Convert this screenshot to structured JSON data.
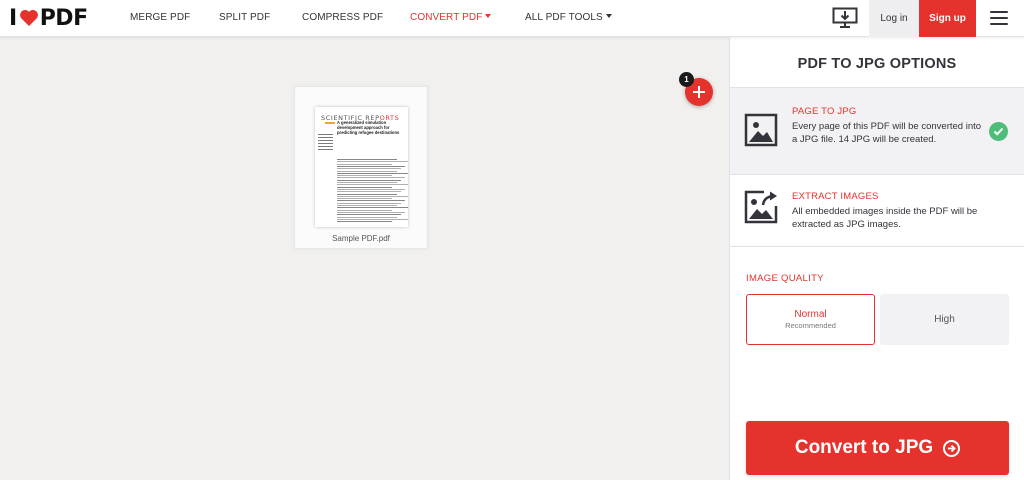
{
  "header": {
    "logo": {
      "prefix": "I",
      "suffix": "PDF"
    },
    "nav": [
      {
        "label": "MERGE PDF"
      },
      {
        "label": "SPLIT PDF"
      },
      {
        "label": "COMPRESS PDF"
      },
      {
        "label": "CONVERT PDF"
      },
      {
        "label": "ALL PDF TOOLS"
      }
    ],
    "login_label": "Log in",
    "signup_label": "Sign up"
  },
  "workspace": {
    "file": {
      "name": "Sample PDF.pdf",
      "preview_title_a": "SCIENTIFIC REP",
      "preview_title_b": "ORTS",
      "preview_heading": "A generalized simulation development approach for predicting refugee destinations"
    },
    "file_count": "1"
  },
  "sidebar": {
    "title": "PDF TO JPG OPTIONS",
    "options": [
      {
        "title": "PAGE TO JPG",
        "desc_a": "Every page of this PDF will be converted into a JPG file. ",
        "desc_count": "14",
        "desc_b": " JPG will be created.",
        "selected": true
      },
      {
        "title": "EXTRACT IMAGES",
        "desc": "All embedded images inside the PDF will be extracted as JPG images.",
        "selected": false
      }
    ],
    "quality": {
      "label": "IMAGE QUALITY",
      "normal": "Normal",
      "normal_sub": "Recommended",
      "high": "High",
      "selected": "Normal"
    },
    "convert_label": "Convert to JPG"
  },
  "colors": {
    "brand": "#e5322d",
    "success": "#4fbd7a",
    "text": "#33333b"
  }
}
